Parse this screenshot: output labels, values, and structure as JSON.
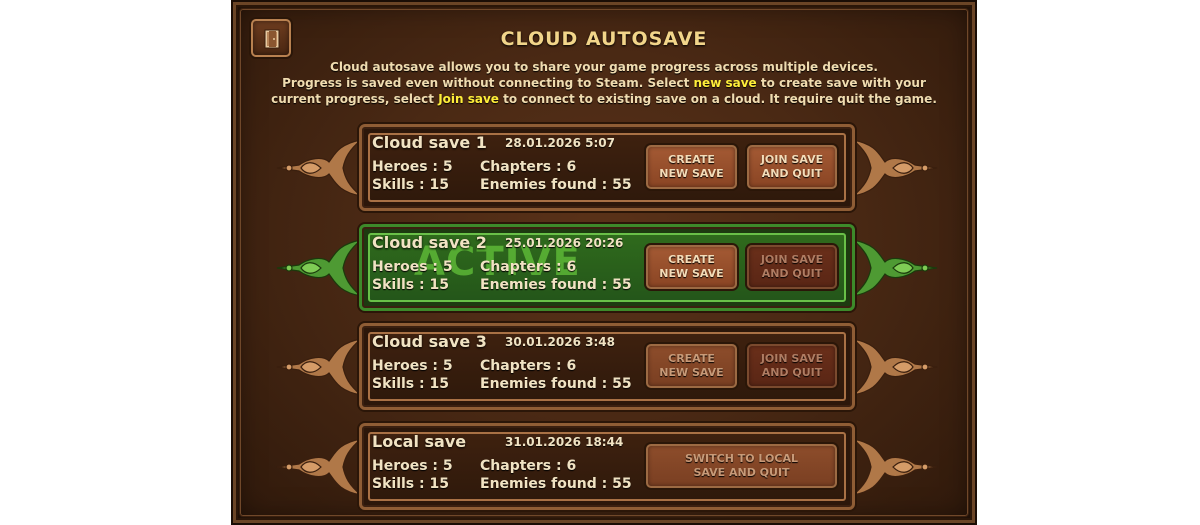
{
  "header": {
    "title": "CLOUD AUTOSAVE",
    "desc_line1": "Cloud autosave allows you to share your game progress across multiple devices.",
    "desc_line2_a": "Progress is saved even without connecting to Steam. Select ",
    "desc_line2_hl": "new save",
    "desc_line2_b": " to create save with your",
    "desc_line3_a": "current progress, select ",
    "desc_line3_hl": "Join save",
    "desc_line3_b": " to connect to existing save on a cloud. It require quit the game."
  },
  "labels": {
    "heroes": "Heroes :",
    "skills": "Skills :",
    "chapters": "Chapters :",
    "enemies": "Enemies found :",
    "create": "CREATE\nNEW SAVE",
    "join": "JOIN SAVE\nAND QUIT",
    "switch": "SWITCH TO LOCAL\nSAVE AND QUIT",
    "active": "ACTIVE"
  },
  "saves": [
    {
      "name": "Cloud save 1",
      "date": "28.01.2026 5:07",
      "heroes": "5",
      "skills": "15",
      "chapters": "6",
      "enemies": "55",
      "active": false
    },
    {
      "name": "Cloud save 2",
      "date": "25.01.2026 20:26",
      "heroes": "5",
      "skills": "15",
      "chapters": "6",
      "enemies": "55",
      "active": true
    },
    {
      "name": "Cloud save 3",
      "date": "30.01.2026 3:48",
      "heroes": "5",
      "skills": "15",
      "chapters": "6",
      "enemies": "55",
      "active": false
    },
    {
      "name": "Local save",
      "date": "31.01.2026 18:44",
      "heroes": "5",
      "skills": "15",
      "chapters": "6",
      "enemies": "55",
      "active": false
    }
  ],
  "colors": {
    "accent_highlight": "#ffee3a",
    "title": "#f2d58a",
    "active_green": "#3d8a2a"
  }
}
